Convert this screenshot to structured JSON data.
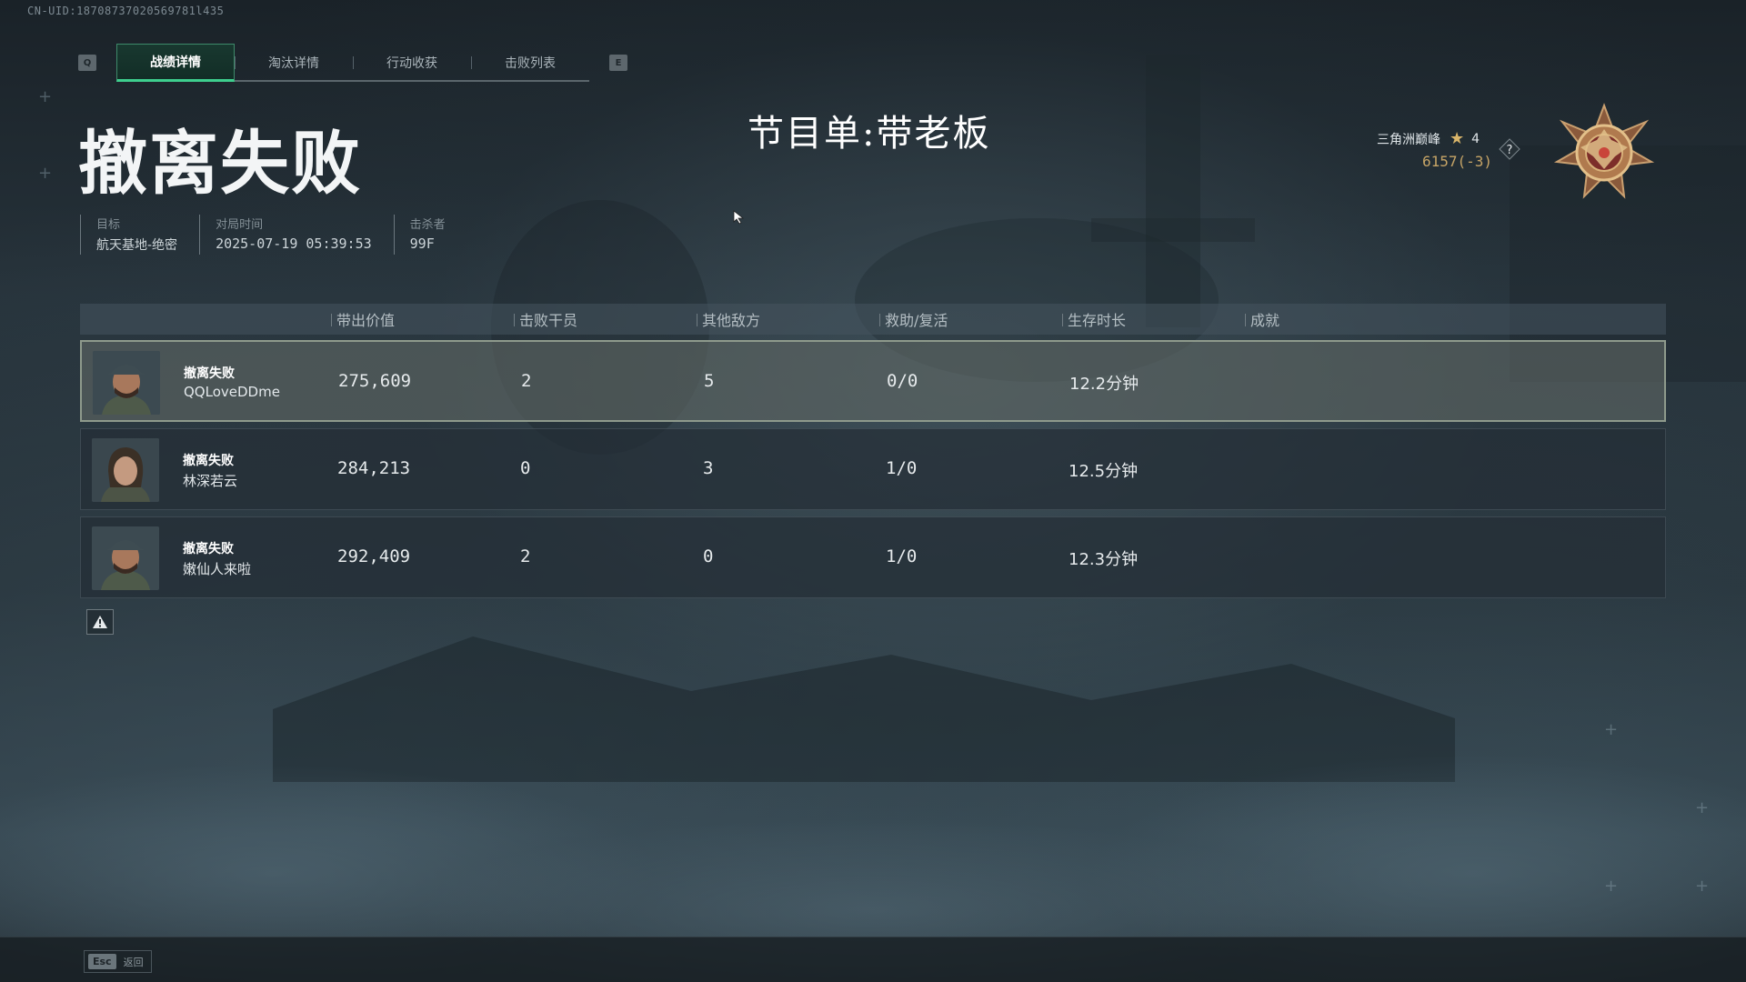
{
  "uid": "CN-UID:18708737020569781l435",
  "tabs": {
    "prev_key": "Q",
    "next_key": "E",
    "items": [
      {
        "label": "战绩详情",
        "active": true
      },
      {
        "label": "淘汰详情",
        "active": false
      },
      {
        "label": "行动收获",
        "active": false
      },
      {
        "label": "击败列表",
        "active": false
      }
    ]
  },
  "headline": "撤离失败",
  "meta": {
    "target_label": "目标",
    "target_value": "航天基地-绝密",
    "time_label": "对局时间",
    "time_value": "2025-07-19 05:39:53",
    "killer_label": "击杀者",
    "killer_value": "99F"
  },
  "overlay_text": "节目单:带老板",
  "rank": {
    "title": "三角洲巅峰",
    "stars": "4",
    "score": "6157(-3)",
    "help": "?"
  },
  "table": {
    "headers": [
      "带出价值",
      "击败干员",
      "其他敌方",
      "救助/复活",
      "生存时长",
      "成就"
    ],
    "rows": [
      {
        "status": "撤离失败",
        "name": "QQLoveDDme",
        "value": "275,609",
        "kills": "2",
        "others": "5",
        "assist": "0/0",
        "duration": "12.2分钟",
        "selected": true
      },
      {
        "status": "撤离失败",
        "name": "林深若云",
        "value": "284,213",
        "kills": "0",
        "others": "3",
        "assist": "1/0",
        "duration": "12.5分钟",
        "selected": false
      },
      {
        "status": "撤离失败",
        "name": "嫩仙人来啦",
        "value": "292,409",
        "kills": "2",
        "others": "0",
        "assist": "1/0",
        "duration": "12.3分钟",
        "selected": false
      }
    ]
  },
  "footer": {
    "esc_key": "Esc",
    "esc_label": "返回"
  },
  "colors": {
    "accent_green": "#3ecf8e",
    "rank_gold": "#c6a466"
  }
}
